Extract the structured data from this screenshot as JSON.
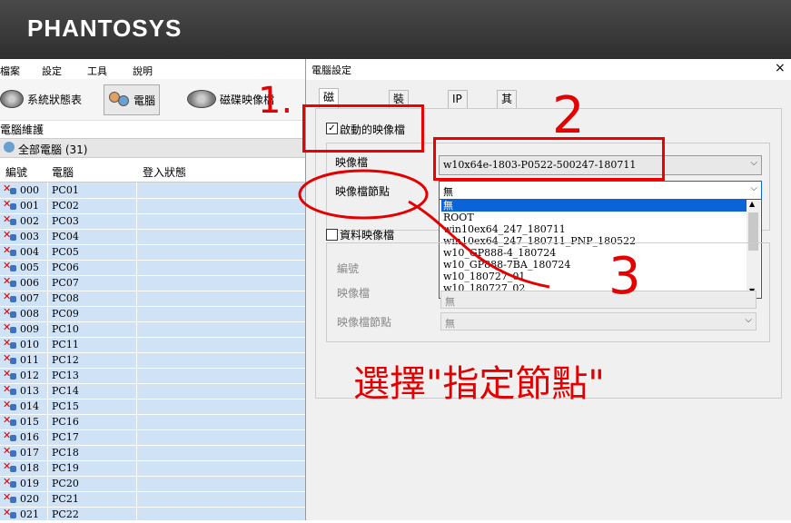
{
  "app": {
    "logo": "PHANTOSYS"
  },
  "menu": [
    "檔案",
    "設定",
    "工具",
    "說明"
  ],
  "toolbar": {
    "status_label": "系統狀態表",
    "computer_label": "電腦",
    "disk_label": "磁碟映像檔"
  },
  "tree": {
    "title": "電腦維護",
    "all_label": "全部電腦 (31)"
  },
  "grid": {
    "headers": [
      "編號",
      "電腦",
      "登入狀態"
    ],
    "rows": [
      {
        "num": "000",
        "name": "PC01"
      },
      {
        "num": "001",
        "name": "PC02"
      },
      {
        "num": "002",
        "name": "PC03"
      },
      {
        "num": "003",
        "name": "PC04"
      },
      {
        "num": "004",
        "name": "PC05"
      },
      {
        "num": "005",
        "name": "PC06"
      },
      {
        "num": "006",
        "name": "PC07"
      },
      {
        "num": "007",
        "name": "PC08"
      },
      {
        "num": "008",
        "name": "PC09"
      },
      {
        "num": "009",
        "name": "PC10"
      },
      {
        "num": "010",
        "name": "PC11"
      },
      {
        "num": "011",
        "name": "PC12"
      },
      {
        "num": "012",
        "name": "PC13"
      },
      {
        "num": "013",
        "name": "PC14"
      },
      {
        "num": "014",
        "name": "PC15"
      },
      {
        "num": "015",
        "name": "PC16"
      },
      {
        "num": "016",
        "name": "PC17"
      },
      {
        "num": "017",
        "name": "PC18"
      },
      {
        "num": "018",
        "name": "PC19"
      },
      {
        "num": "019",
        "name": "PC20"
      },
      {
        "num": "020",
        "name": "PC21"
      },
      {
        "num": "021",
        "name": "PC22"
      }
    ]
  },
  "dialog": {
    "title": "電腦設定",
    "close": "×",
    "tabs": [
      "磁碟映像檔",
      "裝置控管",
      "IP 設定",
      "其它"
    ],
    "boot_image_checkbox": "啟動的映像檔",
    "image_label": "映像檔",
    "image_value": "w10x64e-1803-P0522-500247-180711",
    "node_label": "映像檔節點",
    "node_value": "無",
    "node_options": [
      "無",
      "ROOT",
      "win10ex64_247_180711",
      "win10ex64_247_180711_PNP_180522",
      "w10_GP888-4_180724",
      "w10_GP888-7BA_180724",
      "w10_180727_01",
      "w10_180727_02"
    ],
    "data_image_checkbox": "資料映像檔",
    "data_number_label": "編號",
    "data_image_label": "映像檔",
    "data_node_label": "映像檔節點",
    "data_node_value": "無",
    "data_number_value": "無"
  },
  "annotations": {
    "step1": "1.",
    "step2": "2",
    "step3": "3",
    "instruction": "選擇\"指定節點\"",
    "color": "#e40000"
  }
}
